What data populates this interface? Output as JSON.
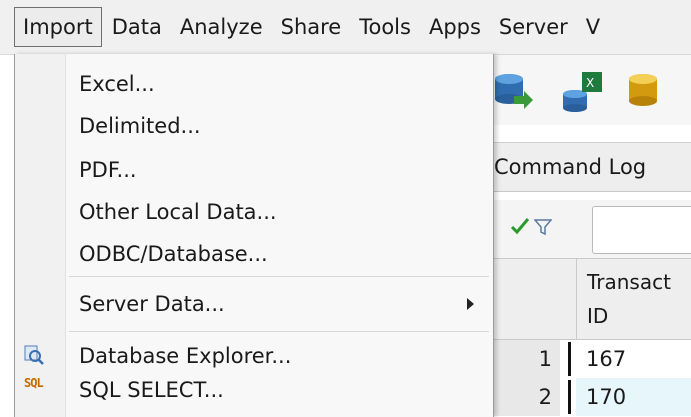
{
  "menubar": {
    "items": [
      "Import",
      "Data",
      "Analyze",
      "Share",
      "Tools",
      "Apps",
      "Server",
      "V"
    ]
  },
  "import_menu": {
    "items": [
      {
        "label": "Excel..."
      },
      {
        "label": "Delimited..."
      },
      {
        "label": "PDF..."
      },
      {
        "label": "Other Local Data..."
      },
      {
        "label": "ODBC/Database..."
      },
      {
        "label": "Server Data...",
        "has_submenu": true
      },
      {
        "label": "Database Explorer...",
        "icon": "database-explorer-icon"
      },
      {
        "label": "SQL SELECT...",
        "icon": "sql-icon",
        "icon_text": "SQL"
      }
    ]
  },
  "tabs": {
    "command_log": "Command Log"
  },
  "grid": {
    "column_header": [
      "Transact",
      "ID"
    ],
    "rows": [
      {
        "num": "1",
        "value": "167"
      },
      {
        "num": "2",
        "value": "170"
      }
    ]
  },
  "colors": {
    "menubar_bg": "#f0f0f0",
    "menu_bg": "#f8f8f8",
    "row_highlight": "#e6f6fb",
    "sql_icon": "#c46a00"
  }
}
